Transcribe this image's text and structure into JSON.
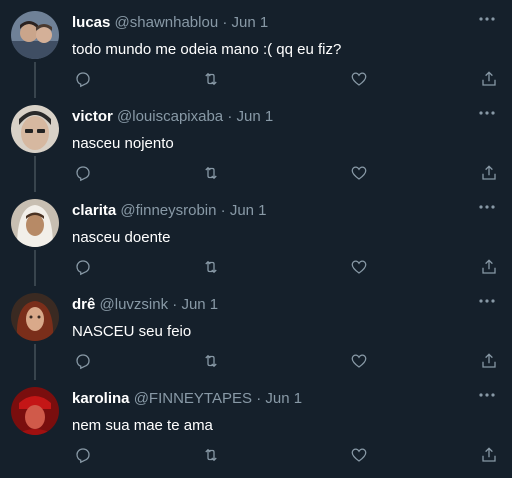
{
  "colors": {
    "background": "#15202b",
    "secondary_text": "#8899a6",
    "thread_line": "#38444d"
  },
  "tweets": [
    {
      "name": "lucas",
      "handle": "@shawnhablou",
      "sep": "·",
      "date": "Jun 1",
      "text": "todo mundo me odeia mano :( qq eu fiz?",
      "avatar_color": "#7a8a9a"
    },
    {
      "name": "victor",
      "handle": "@louiscapixaba",
      "sep": "·",
      "date": "Jun 1",
      "text": "nasceu nojento",
      "avatar_color": "#c9b9a8"
    },
    {
      "name": "clarita",
      "handle": "@finneysrobin",
      "sep": "·",
      "date": "Jun 1",
      "text": "nasceu doente",
      "avatar_color": "#d9d2c6"
    },
    {
      "name": "drê",
      "handle": "@luvzsink",
      "sep": "·",
      "date": "Jun 1",
      "text": "NASCEU seu feio",
      "avatar_color": "#6b3a2a"
    },
    {
      "name": "karolina",
      "handle": "@FINNEYTAPES",
      "sep": "·",
      "date": "Jun 1",
      "text": "nem sua mae te ama",
      "avatar_color": "#b11a1a"
    }
  ],
  "icons": [
    "more-icon",
    "reply-icon",
    "retweet-icon",
    "like-icon",
    "share-icon"
  ]
}
